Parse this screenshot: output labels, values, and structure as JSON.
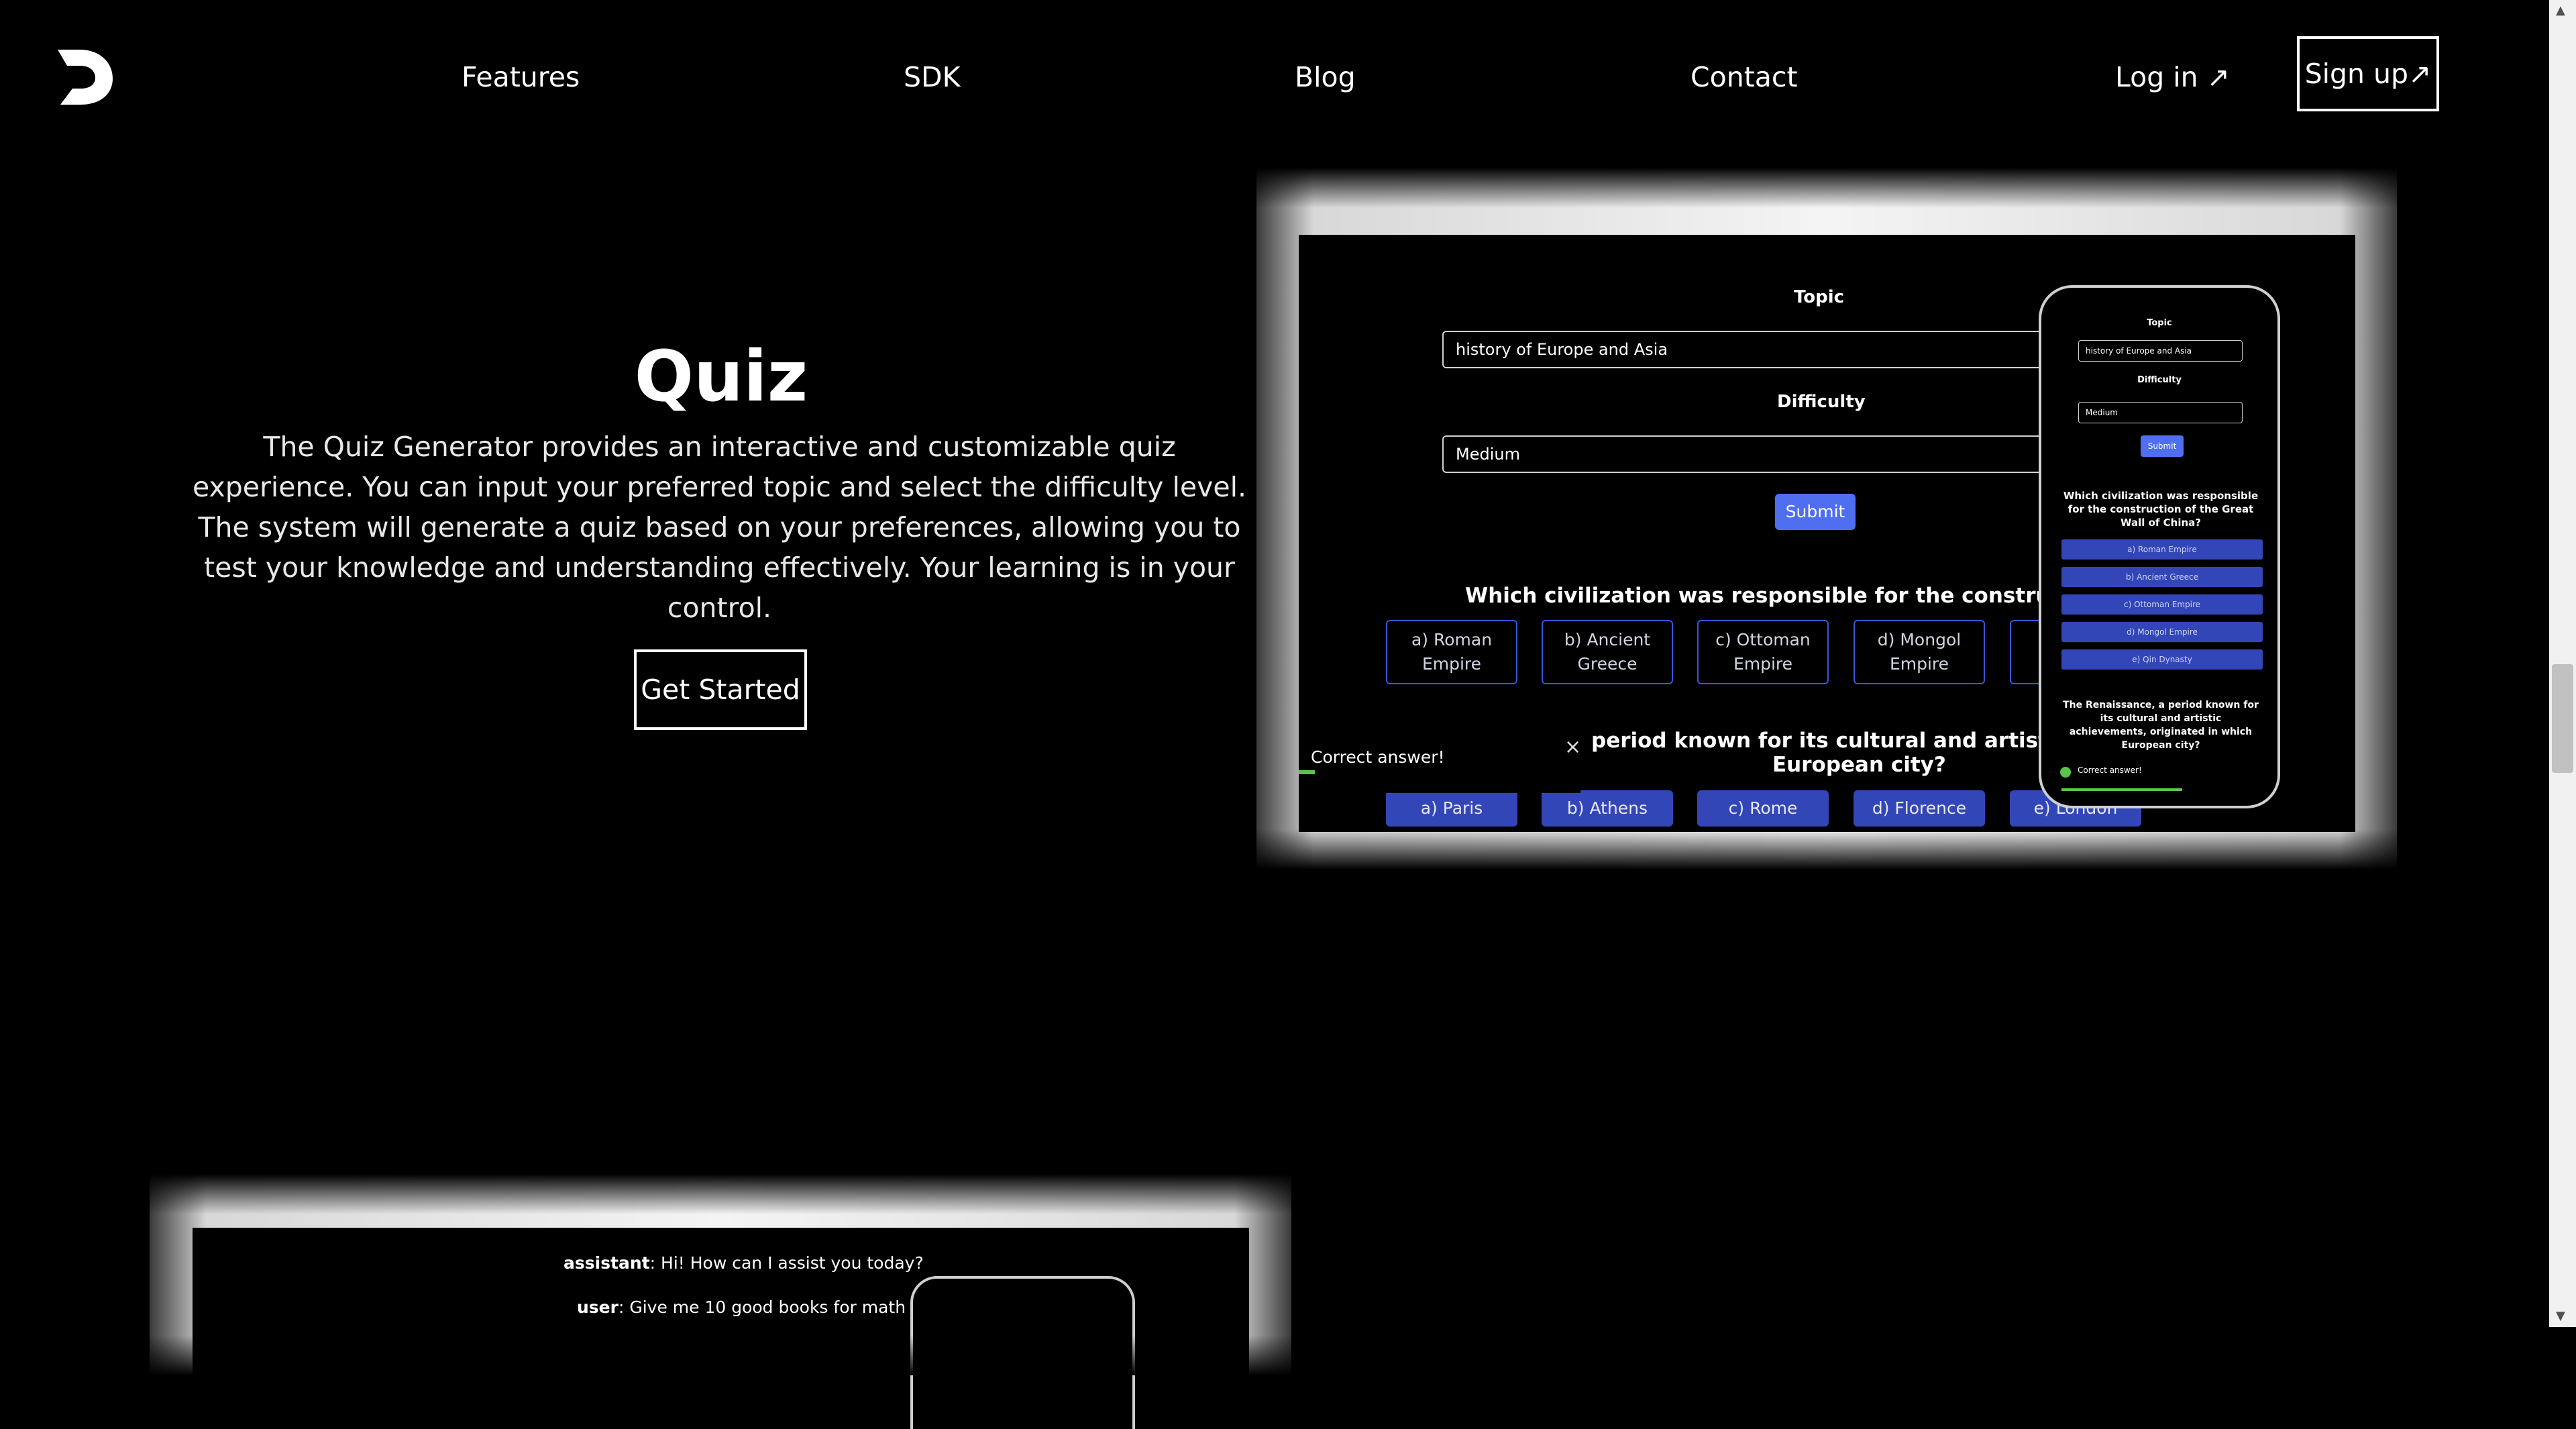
{
  "nav": {
    "links": [
      "Features",
      "SDK",
      "Blog",
      "Contact"
    ],
    "login": "Log in ↗",
    "signup": "Sign up↗"
  },
  "hero": {
    "title": "Quiz",
    "description": "The Quiz Generator provides an interactive and customizable quiz experience. You can input your preferred topic and select the difficulty level. The system will generate a quiz based on your preferences, allowing you to test your knowledge and understanding effectively. Your learning is in your control.",
    "cta": "Get Started"
  },
  "quiz_demo": {
    "topic_label": "Topic",
    "topic_value": "history of Europe and Asia",
    "difficulty_label": "Difficulty",
    "difficulty_value": "Medium",
    "submit": "Submit",
    "q1": "Which civilization was responsible for the construction of the G",
    "q1_options": [
      "a) Roman Empire",
      "b) Ancient Greece",
      "c) Ottoman Empire",
      "d) Mongol Empire"
    ],
    "q2_line1": "period known for its cultural and artistic achieven",
    "q2_line2": "European city?",
    "q2_options": [
      "a) Paris",
      "b) Athens",
      "c) Rome",
      "d) Florence",
      "e) London"
    ],
    "toast": "Correct answer!",
    "close": "×"
  },
  "phone_demo": {
    "topic_label": "Topic",
    "topic_value": "history of Europe and Asia",
    "difficulty_label": "Difficulty",
    "difficulty_value": "Medium",
    "submit": "Submit",
    "q1": "Which civilization was responsible for the construction of the Great Wall of China?",
    "q1_options": [
      "a) Roman Empire",
      "b) Ancient Greece",
      "c) Ottoman Empire",
      "d) Mongol Empire",
      "e) Qin Dynasty"
    ],
    "q2": "The Renaissance, a period known for its cultural and artistic achievements, originated in which European city?",
    "toast": "Correct answer!"
  },
  "chat_demo": {
    "line1_role": "assistant",
    "line1_text": ": Hi! How can I assist you today?",
    "line2_role": "user",
    "line2_text": ": Give me 10 good books for math"
  },
  "colors": {
    "accent": "#4f6ef0",
    "option": "#3346b8",
    "success": "#5cc44b"
  }
}
